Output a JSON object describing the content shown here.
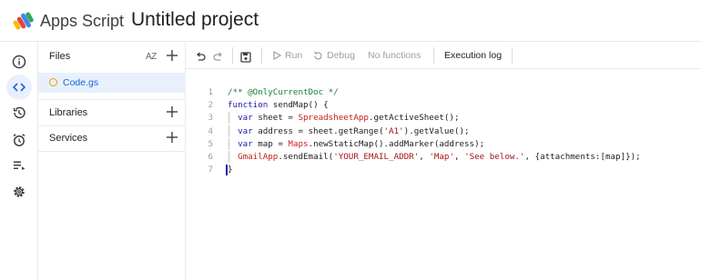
{
  "header": {
    "app_name": "Apps Script",
    "project_title": "Untitled project"
  },
  "rail": [
    {
      "icon": "info-icon"
    },
    {
      "icon": "code-icon",
      "active": true
    },
    {
      "icon": "history-icon"
    },
    {
      "icon": "alarm-icon"
    },
    {
      "icon": "executions-icon"
    },
    {
      "icon": "settings-gear-icon"
    }
  ],
  "files_panel": {
    "files_label": "Files",
    "sort_label": "AZ",
    "files": [
      {
        "name": "Code.gs",
        "selected": true
      }
    ],
    "libraries_label": "Libraries",
    "services_label": "Services"
  },
  "toolbar": {
    "run_label": "Run",
    "debug_label": "Debug",
    "functions_label": "No functions",
    "execution_log_label": "Execution log"
  },
  "editor": {
    "lines": [
      {
        "num": "1",
        "tokens": [
          {
            "t": "/** @OnlyCurrentDoc */",
            "c": "c-comment"
          }
        ]
      },
      {
        "num": "2",
        "tokens": [
          {
            "t": "function ",
            "c": "c-kw"
          },
          {
            "t": "sendMap",
            "c": "c-fn"
          },
          {
            "t": "() {",
            "c": "c-fn"
          }
        ]
      },
      {
        "num": "3",
        "tokens": [
          {
            "t": "  var ",
            "c": "c-kw"
          },
          {
            "t": "sheet = ",
            "c": "c-fn"
          },
          {
            "t": "SpreadsheetApp",
            "c": "c-cls"
          },
          {
            "t": ".getActiveSheet();",
            "c": "c-fn"
          }
        ]
      },
      {
        "num": "4",
        "tokens": [
          {
            "t": "  var ",
            "c": "c-kw"
          },
          {
            "t": "address = sheet.getRange(",
            "c": "c-fn"
          },
          {
            "t": "'A1'",
            "c": "c-str"
          },
          {
            "t": ").getValue();",
            "c": "c-fn"
          }
        ]
      },
      {
        "num": "5",
        "tokens": [
          {
            "t": "  var ",
            "c": "c-kw"
          },
          {
            "t": "map = ",
            "c": "c-fn"
          },
          {
            "t": "Maps",
            "c": "c-cls"
          },
          {
            "t": ".newStaticMap().addMarker(address);",
            "c": "c-fn"
          }
        ]
      },
      {
        "num": "6",
        "tokens": [
          {
            "t": "  ",
            "c": "c-fn"
          },
          {
            "t": "GmailApp",
            "c": "c-cls"
          },
          {
            "t": ".sendEmail(",
            "c": "c-fn"
          },
          {
            "t": "'YOUR_EMAIL_ADDR'",
            "c": "c-str"
          },
          {
            "t": ", ",
            "c": "c-fn"
          },
          {
            "t": "'Map'",
            "c": "c-str"
          },
          {
            "t": ", ",
            "c": "c-fn"
          },
          {
            "t": "'See below.'",
            "c": "c-str"
          },
          {
            "t": ", {attachments:[map]});",
            "c": "c-fn"
          }
        ]
      },
      {
        "num": "7",
        "tokens": [
          {
            "t": "}",
            "c": "c-fn"
          }
        ]
      }
    ]
  }
}
